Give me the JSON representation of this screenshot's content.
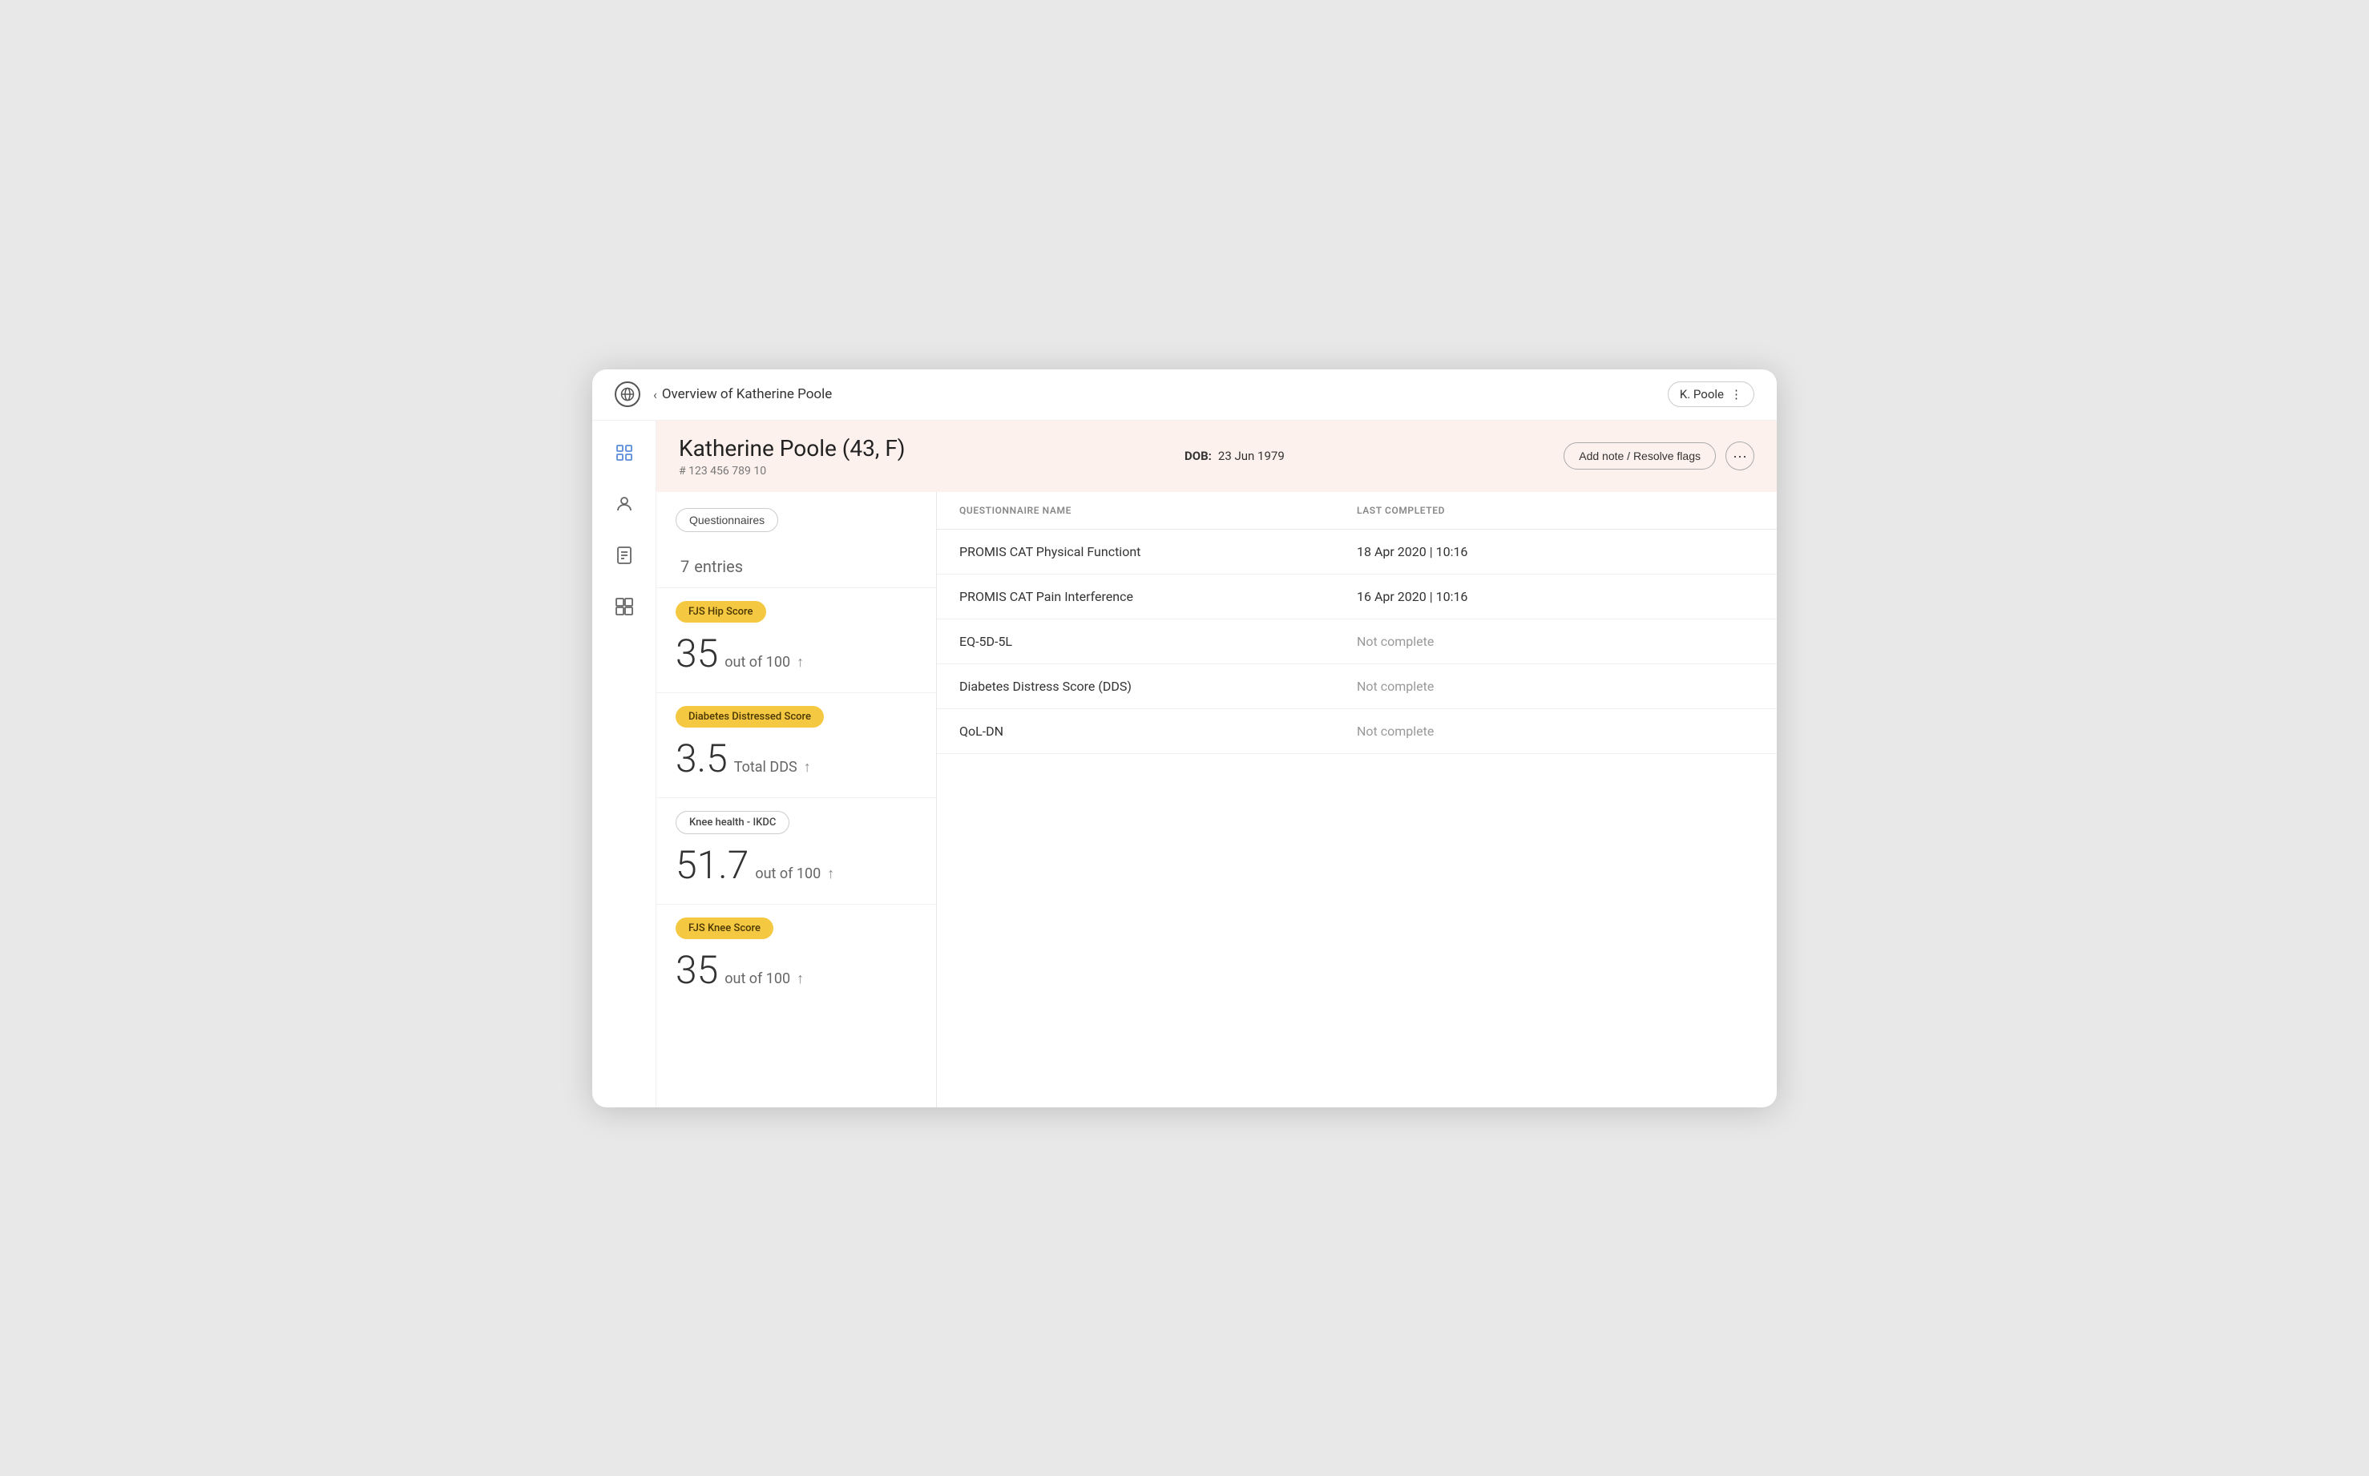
{
  "topBar": {
    "backLabel": "Overview of Katherine Poole",
    "userName": "K. Poole"
  },
  "patient": {
    "name": "Katherine Poole",
    "age": "43",
    "sex": "F",
    "dob_label": "DOB:",
    "dob_value": "23 Jun 1979",
    "id": "# 123 456 789 10",
    "addNoteLabel": "Add note / Resolve flags"
  },
  "sidebar": {
    "icons": [
      "globe",
      "person",
      "document",
      "image-grid"
    ]
  },
  "leftPanel": {
    "questionnairesLabel": "Questionnaires",
    "entriesCount": "7",
    "entriesLabel": "entries",
    "scores": [
      {
        "badge": "FJS Hip Score",
        "badgeStyle": "yellow",
        "value": "35",
        "label": "out of 100",
        "hasArrow": true
      },
      {
        "badge": "Diabetes Distressed Score",
        "badgeStyle": "yellow",
        "value": "3.5",
        "label": "Total DDS",
        "hasArrow": true
      },
      {
        "badge": "Knee health - IKDC",
        "badgeStyle": "outline",
        "value": "51.7",
        "label": "out of 100",
        "hasArrow": true
      },
      {
        "badge": "FJS Knee Score",
        "badgeStyle": "yellow",
        "value": "35",
        "label": "out of 100",
        "hasArrow": true
      }
    ]
  },
  "rightPanel": {
    "headers": [
      "QUESTIONNAIRE NAME",
      "LAST COMPLETED"
    ],
    "rows": [
      {
        "name": "PROMIS CAT Physical Functiont",
        "lastCompleted": "18 Apr 2020 | 10:16"
      },
      {
        "name": "PROMIS CAT Pain Interference",
        "lastCompleted": "16 Apr 2020 | 10:16"
      },
      {
        "name": "EQ-5D-5L",
        "lastCompleted": "Not complete"
      },
      {
        "name": "Diabetes Distress Score (DDS)",
        "lastCompleted": "Not complete"
      },
      {
        "name": "QoL-DN",
        "lastCompleted": "Not complete"
      }
    ]
  }
}
